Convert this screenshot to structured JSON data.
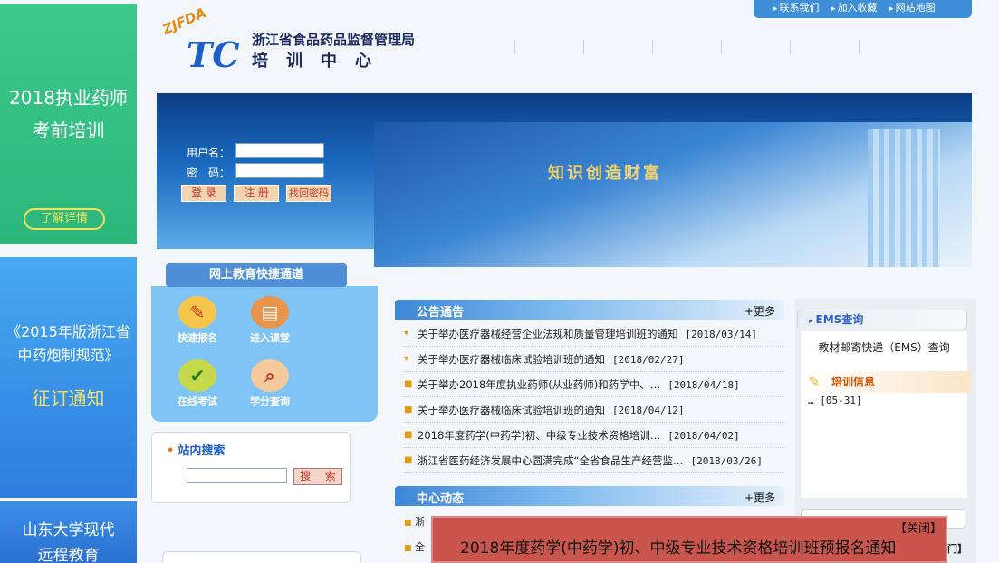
{
  "ads": {
    "ad1_text": "2018执业药师\n考前培训",
    "ad1_button": "了解详情",
    "ad2_text": "《2015年版浙江省\n中药炮制规范》",
    "ad2_sub": "征订通知",
    "ad3_text": "山东大学现代\n远程教育"
  },
  "top_links": [
    "联系我们",
    "加入收藏",
    "网站地图"
  ],
  "header": {
    "logo_small": "ZJFDA",
    "logo_big": "TC",
    "org_name": "浙江省食品药品监督管理局",
    "org_sub": "培训中心"
  },
  "banner": {
    "slogan": "知识创造财富"
  },
  "login": {
    "username_label": "用户名：",
    "password_label": "密　码：",
    "login_button": "登 录",
    "register_button": "注 册",
    "recover_button": "找回密码"
  },
  "quick": {
    "title": "网上教育快捷通道",
    "items": [
      "快速报名",
      "进入课堂",
      "在线考试",
      "学分查询"
    ]
  },
  "search": {
    "title": "站内搜索",
    "button": "搜 索"
  },
  "announcements": {
    "title": "公告通告",
    "more": "+更多",
    "items": [
      {
        "text": "关于举办医疗器械经营企业法规和质量管理培训班的通知",
        "date": "[2018/03/14]"
      },
      {
        "text": "关于举办医疗器械临床试验培训班的通知",
        "date": "[2018/02/27]"
      },
      {
        "text": "关于举办2018年度执业药师(从业药师)和药学中、…",
        "date": "[2018/04/18]"
      },
      {
        "text": "关于举办医疗器械临床试验培训班的通知",
        "date": "[2018/04/12]"
      },
      {
        "text": "2018年度药学(中药学)初、中级专业技术资格培训…",
        "date": "[2018/04/02]"
      },
      {
        "text": "浙江省医药经济发展中心圆满完成“全省食品生产经营监…",
        "date": "[2018/03/26]"
      }
    ]
  },
  "news": {
    "title": "中心动态",
    "more": "+更多",
    "peek": [
      "浙",
      "全"
    ]
  },
  "ems": {
    "title": "EMS查询",
    "text": "教材邮寄快递（EMS）查询"
  },
  "training": {
    "title": "培训信息",
    "item": "… [05-31]"
  },
  "popup": {
    "close": "【关闭】",
    "message": "2018年度药学(中药学)初、中级专业技术资格培训班预报名通知",
    "peek": "门】"
  }
}
